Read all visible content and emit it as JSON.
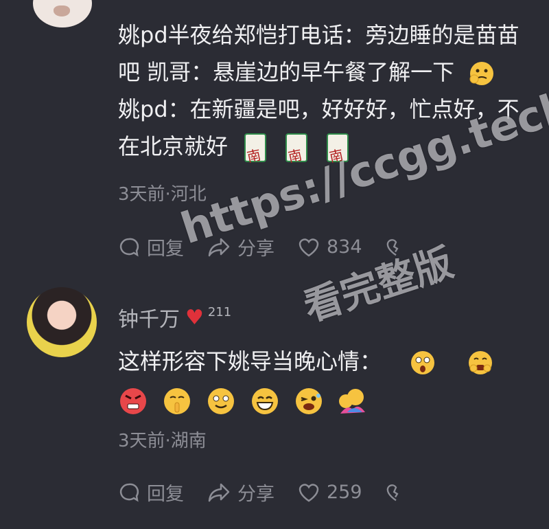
{
  "comment1": {
    "text": "姚pd半夜给郑恺打电话：旁边睡的是苗苗吧 凯哥：悬崖边的早午餐了解一下",
    "text2": "姚pd：在新疆是吧，好好好，忙点好，不在北京就好",
    "meta": "3天前·河北",
    "reply": "回复",
    "share": "分享",
    "likes": "834"
  },
  "comment2": {
    "name": "钟千万",
    "badge_count": "211",
    "text": "这样形容下姚导当晚心情：",
    "meta": "3天前·湖南",
    "reply": "回复",
    "share": "分享",
    "likes": "259"
  },
  "watermark": {
    "line1": "https://ccgg.tech",
    "line2": "看完整版"
  },
  "colors": {
    "background": "#2b2c34",
    "text": "#f0f0f2",
    "muted": "#8d8e96",
    "heart": "#e0313a"
  }
}
